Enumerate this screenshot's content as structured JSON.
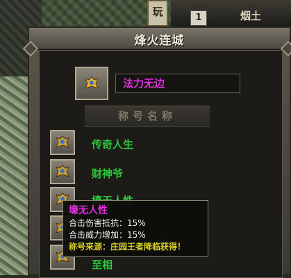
{
  "hud": {
    "tab_label": "玩",
    "level_number": "1",
    "right_text": "烟土"
  },
  "window": {
    "title": "烽火连城"
  },
  "current_title": {
    "name": "法力无边",
    "icon": "title-emblem-icon"
  },
  "section_header": "称号名称",
  "titles": [
    {
      "name": "传奇人生",
      "icon": "title-emblem-icon"
    },
    {
      "name": "财神爷",
      "icon": "title-emblem-icon"
    },
    {
      "name": "壕无人性",
      "icon": "title-emblem-icon"
    },
    {
      "name": "",
      "icon": "title-emblem-icon"
    },
    {
      "name": "至相",
      "icon": "title-emblem-icon"
    }
  ],
  "tooltip": {
    "title": "壕无人性",
    "line1": "合击伤害抵抗：15%",
    "line2": "合击威力增加：15%",
    "source": "称号来源：庄园王者降临获得！"
  },
  "colors": {
    "title_name": "#e12ee0",
    "list_name": "#2fc63a",
    "tooltip_source": "#d9cf2a"
  }
}
